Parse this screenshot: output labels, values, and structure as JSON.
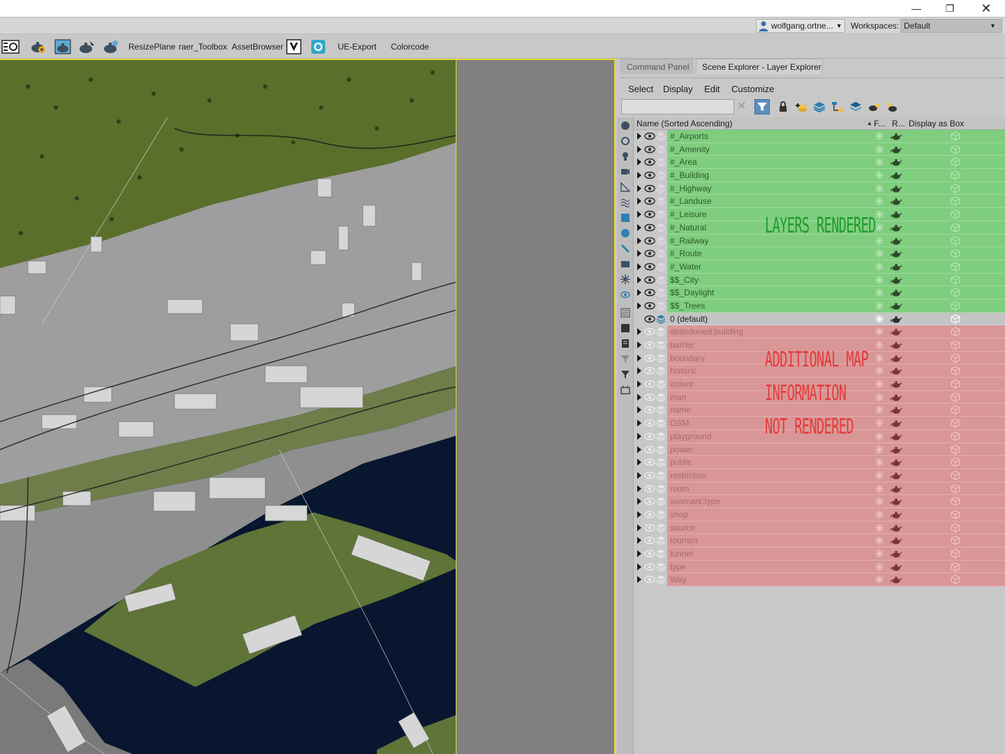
{
  "window": {
    "min_glyph": "—",
    "max_glyph": "❐",
    "close_glyph": "✕"
  },
  "account": {
    "user": "wolfgang.ortne...",
    "workspaces_label": "Workspaces:",
    "workspace": "Default"
  },
  "toolbar": {
    "resize_plane": "ResizePlane",
    "raer_toolbox": "raer_Toolbox",
    "asset_browser": "AssetBrowser",
    "ue_export": "UE-Export",
    "colorcode": "Colorcode"
  },
  "panel": {
    "tab_command": "Command Panel",
    "tab_scene": "Scene Explorer - Layer Explorer",
    "menu": [
      "Select",
      "Display",
      "Edit",
      "Customize"
    ],
    "search_placeholder": "",
    "col_name": "Name (Sorted Ascending)",
    "col_sort_arrow": "▲",
    "col_freeze": "F...",
    "col_render": "R...",
    "col_box": "Display as Box"
  },
  "layers": [
    {
      "name": "#_Airports",
      "status": "green"
    },
    {
      "name": "#_Amenity",
      "status": "green"
    },
    {
      "name": "#_Area",
      "status": "green"
    },
    {
      "name": "#_Building",
      "status": "green"
    },
    {
      "name": "#_Highway",
      "status": "green"
    },
    {
      "name": "#_Landuse",
      "status": "green"
    },
    {
      "name": "#_Leisure",
      "status": "green"
    },
    {
      "name": "#_Natural",
      "status": "green"
    },
    {
      "name": "#_Railway",
      "status": "green"
    },
    {
      "name": "#_Route",
      "status": "green"
    },
    {
      "name": "#_Water",
      "status": "green"
    },
    {
      "name": "$$_City",
      "status": "green"
    },
    {
      "name": "$$_Daylight",
      "status": "green"
    },
    {
      "name": "$$_Trees",
      "status": "green"
    },
    {
      "name": "0 (default)",
      "status": "default"
    },
    {
      "name": "abandoned:building",
      "status": "red"
    },
    {
      "name": "barrier",
      "status": "red"
    },
    {
      "name": "boundary",
      "status": "red"
    },
    {
      "name": "historic",
      "status": "red"
    },
    {
      "name": "indoor",
      "status": "red"
    },
    {
      "name": "man",
      "status": "red"
    },
    {
      "name": "name",
      "status": "red"
    },
    {
      "name": "OSM",
      "status": "red"
    },
    {
      "name": "playground",
      "status": "red"
    },
    {
      "name": "power",
      "status": "red"
    },
    {
      "name": "public",
      "status": "red"
    },
    {
      "name": "restriction",
      "status": "red"
    },
    {
      "name": "room",
      "status": "red"
    },
    {
      "name": "seamark:type",
      "status": "red"
    },
    {
      "name": "shop",
      "status": "red"
    },
    {
      "name": "source",
      "status": "red"
    },
    {
      "name": "tourism",
      "status": "red"
    },
    {
      "name": "tunnel",
      "status": "red"
    },
    {
      "name": "type",
      "status": "red"
    },
    {
      "name": "Way",
      "status": "red"
    }
  ],
  "annotations": {
    "rendered": "LAYERS RENDERED",
    "additional_1": "ADDITIONAL MAP",
    "additional_2": "INFORMATION",
    "additional_3": "NOT RENDERED"
  },
  "colors": {
    "rendered": "#7fce7f",
    "not_rendered": "#d99696",
    "annotation_green": "#1f9a2b",
    "annotation_red": "#e23b3b",
    "viewport_border": "#e4d93a"
  }
}
